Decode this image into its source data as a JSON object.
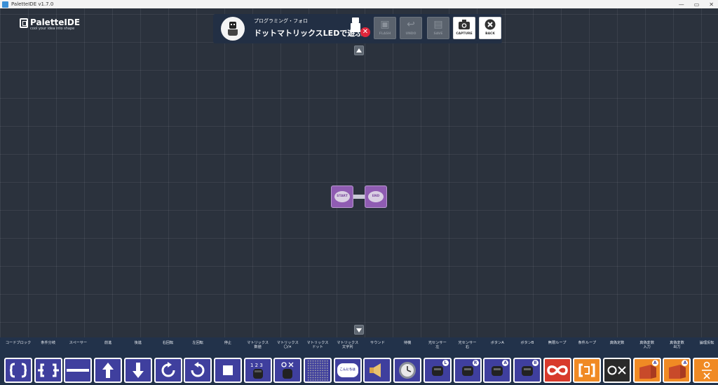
{
  "window": {
    "title": "PaletteIDE v1.7.0",
    "controls": [
      "—",
      "▭",
      "✕"
    ]
  },
  "logo": {
    "name": "PaletteIDE",
    "tagline": "cool your idea into shape"
  },
  "course": {
    "subtitle": "プログラミング・フォロ",
    "title": "ドットマトリックスLEDで遊ぶ"
  },
  "toolbar": {
    "flash": "FLASH",
    "undo": "UNDO",
    "save": "SAVE",
    "capture": "CAPTURE",
    "back": "BACK"
  },
  "blocks": {
    "start": "START",
    "end": "END"
  },
  "palette": [
    {
      "label": "コードブロック",
      "icon": "code-block-icon",
      "style": "blue"
    },
    {
      "label": "条件分岐",
      "icon": "branch-icon",
      "style": "blue"
    },
    {
      "label": "スペーサー",
      "icon": "spacer-icon",
      "style": "blue"
    },
    {
      "label": "前進",
      "icon": "arrow-up-icon",
      "style": "blue"
    },
    {
      "label": "後進",
      "icon": "arrow-down-icon",
      "style": "blue"
    },
    {
      "label": "右回転",
      "icon": "rotate-right-icon",
      "style": "blue"
    },
    {
      "label": "左回転",
      "icon": "rotate-left-icon",
      "style": "blue"
    },
    {
      "label": "停止",
      "icon": "stop-icon",
      "style": "blue"
    },
    {
      "label": "マトリックス\n数値",
      "icon": "matrix-number-icon",
      "style": "blue"
    },
    {
      "label": "マトリックス\n〇/✕",
      "icon": "matrix-ox-icon",
      "style": "blue"
    },
    {
      "label": "マトリックス\nドット",
      "icon": "matrix-dot-icon",
      "style": "blue"
    },
    {
      "label": "マトリックス\n文字列",
      "icon": "matrix-text-icon",
      "style": "blue",
      "bubble": "こんにちは"
    },
    {
      "label": "サウンド",
      "icon": "speaker-icon",
      "style": "blue"
    },
    {
      "label": "待機",
      "icon": "clock-icon",
      "style": "blue"
    },
    {
      "label": "光センサー\n左",
      "icon": "light-sensor-left-icon",
      "style": "blue",
      "badge": "L"
    },
    {
      "label": "光センサー\n右",
      "icon": "light-sensor-right-icon",
      "style": "blue",
      "badge": "R"
    },
    {
      "label": "ボタンA",
      "icon": "button-a-icon",
      "style": "blue",
      "badge": "A"
    },
    {
      "label": "ボタンB",
      "icon": "button-b-icon",
      "style": "blue",
      "badge": "B"
    },
    {
      "label": "無限ループ",
      "icon": "infinite-loop-icon",
      "style": "red"
    },
    {
      "label": "条件ループ",
      "icon": "condition-loop-icon",
      "style": "orange"
    },
    {
      "label": "真偽定数",
      "icon": "boolean-constant-icon",
      "style": "dark"
    },
    {
      "label": "真偽変数\n入力",
      "icon": "boolean-var-input-icon",
      "style": "orange",
      "badge": "A"
    },
    {
      "label": "真偽変数\n出力",
      "icon": "boolean-var-output-icon",
      "style": "orange",
      "badge": "A"
    },
    {
      "label": "論理反転",
      "icon": "logic-not-icon",
      "style": "orange"
    }
  ],
  "colors": {
    "canvas": "#2b323d",
    "palette_bg": "#22324a",
    "block_purple": "#8f5cb2",
    "block_blue": "#3f3f9e",
    "block_orange": "#f08a24",
    "block_red": "#d83a2c"
  }
}
